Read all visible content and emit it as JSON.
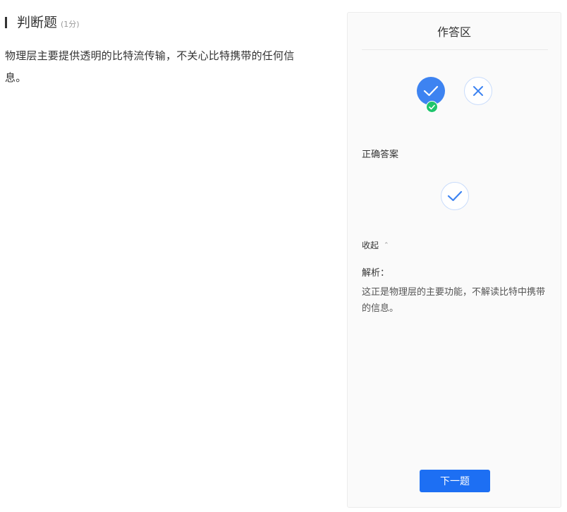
{
  "question": {
    "type_label": "判断题",
    "score_label": "(1分)",
    "text": "物理层主要提供透明的比特流传输，不关心比特携带的任何信息。"
  },
  "answer_panel": {
    "title": "作答区",
    "options": [
      {
        "name": "true",
        "icon": "check-icon",
        "selected": true
      },
      {
        "name": "false",
        "icon": "close-icon",
        "selected": false
      }
    ],
    "selected_badge_icon": "check-icon",
    "correct_answer_label": "正确答案",
    "correct_answer_icon": "check-icon",
    "collapse_label": "收起",
    "collapse_icon": "chevron-up-icon",
    "analysis_label": "解析：",
    "analysis_text": "这正是物理层的主要功能，不解读比特中携带的信息。",
    "next_button_label": "下一题"
  },
  "colors": {
    "primary": "#1d6ff3",
    "selected_fill": "#3d83f1",
    "option_border": "#c9dcfb",
    "success_badge": "#1fc46c",
    "panel_bg": "#fafafa"
  }
}
